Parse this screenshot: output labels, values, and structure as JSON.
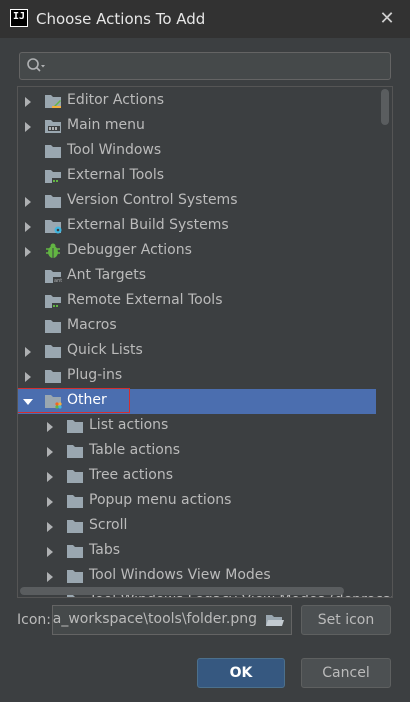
{
  "title": "Choose Actions To Add",
  "search": {
    "placeholder": ""
  },
  "tree": {
    "items": [
      {
        "label": "Editor Actions",
        "expanded": false,
        "has_arrow": true,
        "icon": "editor-actions-folder-icon"
      },
      {
        "label": "Main menu",
        "expanded": false,
        "has_arrow": true,
        "icon": "main-menu-folder-icon"
      },
      {
        "label": "Tool Windows",
        "expanded": false,
        "has_arrow": false,
        "icon": "folder-icon"
      },
      {
        "label": "External Tools",
        "expanded": false,
        "has_arrow": false,
        "icon": "external-tools-folder-icon"
      },
      {
        "label": "Version Control Systems",
        "expanded": false,
        "has_arrow": true,
        "icon": "folder-icon"
      },
      {
        "label": "External Build Systems",
        "expanded": false,
        "has_arrow": true,
        "icon": "build-folder-icon"
      },
      {
        "label": "Debugger Actions",
        "expanded": false,
        "has_arrow": true,
        "icon": "bug-icon"
      },
      {
        "label": "Ant Targets",
        "expanded": false,
        "has_arrow": false,
        "icon": "ant-folder-icon"
      },
      {
        "label": "Remote External Tools",
        "expanded": false,
        "has_arrow": false,
        "icon": "remote-tools-folder-icon"
      },
      {
        "label": "Macros",
        "expanded": false,
        "has_arrow": false,
        "icon": "folder-icon"
      },
      {
        "label": "Quick Lists",
        "expanded": false,
        "has_arrow": true,
        "icon": "folder-icon"
      },
      {
        "label": "Plug-ins",
        "expanded": false,
        "has_arrow": true,
        "icon": "folder-icon"
      },
      {
        "label": "Other",
        "expanded": true,
        "has_arrow": true,
        "icon": "other-folder-icon",
        "selected": true
      },
      {
        "label": "List actions",
        "expanded": false,
        "has_arrow": true,
        "icon": "folder-icon"
      },
      {
        "label": "Table actions",
        "expanded": false,
        "has_arrow": true,
        "icon": "folder-icon"
      },
      {
        "label": "Tree actions",
        "expanded": false,
        "has_arrow": true,
        "icon": "folder-icon"
      },
      {
        "label": "Popup menu actions",
        "expanded": false,
        "has_arrow": true,
        "icon": "folder-icon"
      },
      {
        "label": "Scroll",
        "expanded": false,
        "has_arrow": true,
        "icon": "folder-icon"
      },
      {
        "label": "Tabs",
        "expanded": false,
        "has_arrow": true,
        "icon": "folder-icon"
      },
      {
        "label": "Tool Windows View Modes",
        "expanded": false,
        "has_arrow": true,
        "icon": "folder-icon"
      },
      {
        "label": "Tool Windows Legacy View Modes (deprecated)",
        "expanded": false,
        "has_arrow": true,
        "icon": "folder-icon"
      }
    ]
  },
  "icon_field": {
    "label": "Icon:",
    "value": "ea_workspace\\tools\\folder.png",
    "set_icon_label": "Set icon"
  },
  "buttons": {
    "ok": "OK",
    "cancel": "Cancel"
  },
  "colors": {
    "selection": "#4b6eaf",
    "background": "#3c3f41",
    "highlight_box": "#d32f2f"
  }
}
